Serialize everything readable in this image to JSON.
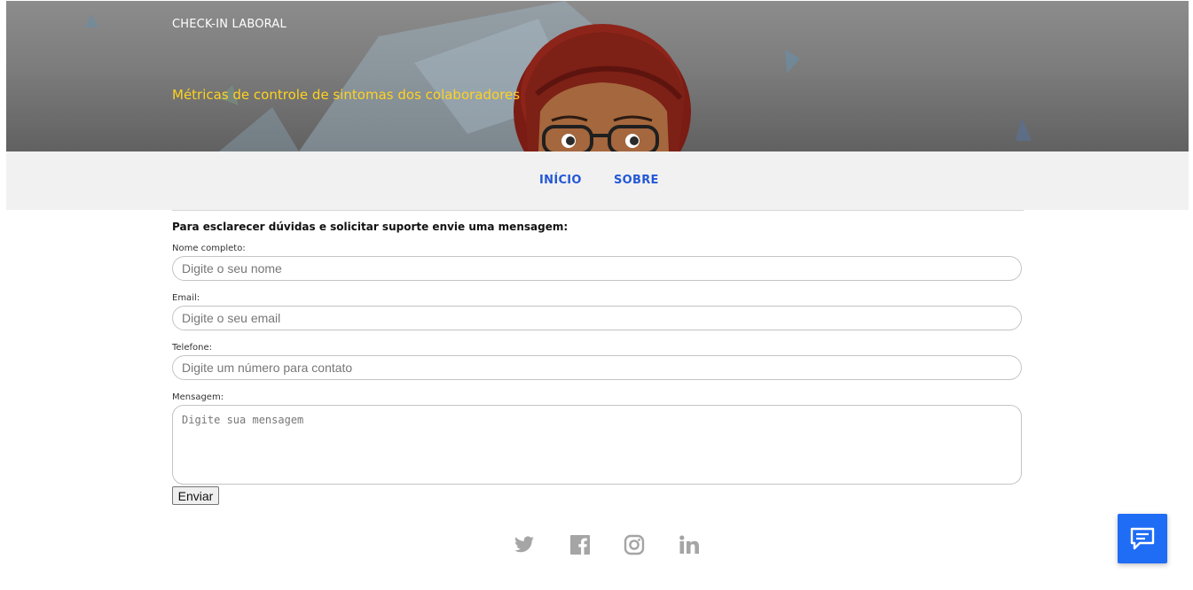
{
  "header": {
    "title": "CHECK-IN LABORAL",
    "subtitle": "Métricas de controle de sintomas dos colaboradores"
  },
  "nav": {
    "items": [
      {
        "label": "INÍCIO"
      },
      {
        "label": "SOBRE"
      }
    ]
  },
  "form": {
    "heading": "Para esclarecer dúvidas e solicitar suporte envie uma mensagem:",
    "name": {
      "label": "Nome completo:",
      "placeholder": "Digite o seu nome"
    },
    "email": {
      "label": "Email:",
      "placeholder": "Digite o seu email"
    },
    "phone": {
      "label": "Telefone:",
      "placeholder": "Digite um número para contato"
    },
    "message": {
      "label": "Mensagem:",
      "placeholder": "Digite sua mensagem"
    },
    "submit_label": "Enviar"
  },
  "footer": {
    "social_icons": [
      "twitter-icon",
      "facebook-icon",
      "instagram-icon",
      "linkedin-icon"
    ]
  },
  "chat_widget": {
    "icon": "chat-icon"
  },
  "colors": {
    "accent_yellow": "#ffd21f",
    "nav_link": "#2458d6",
    "chat_button": "#1f6cf5",
    "social_icon": "#a5a5a5"
  }
}
